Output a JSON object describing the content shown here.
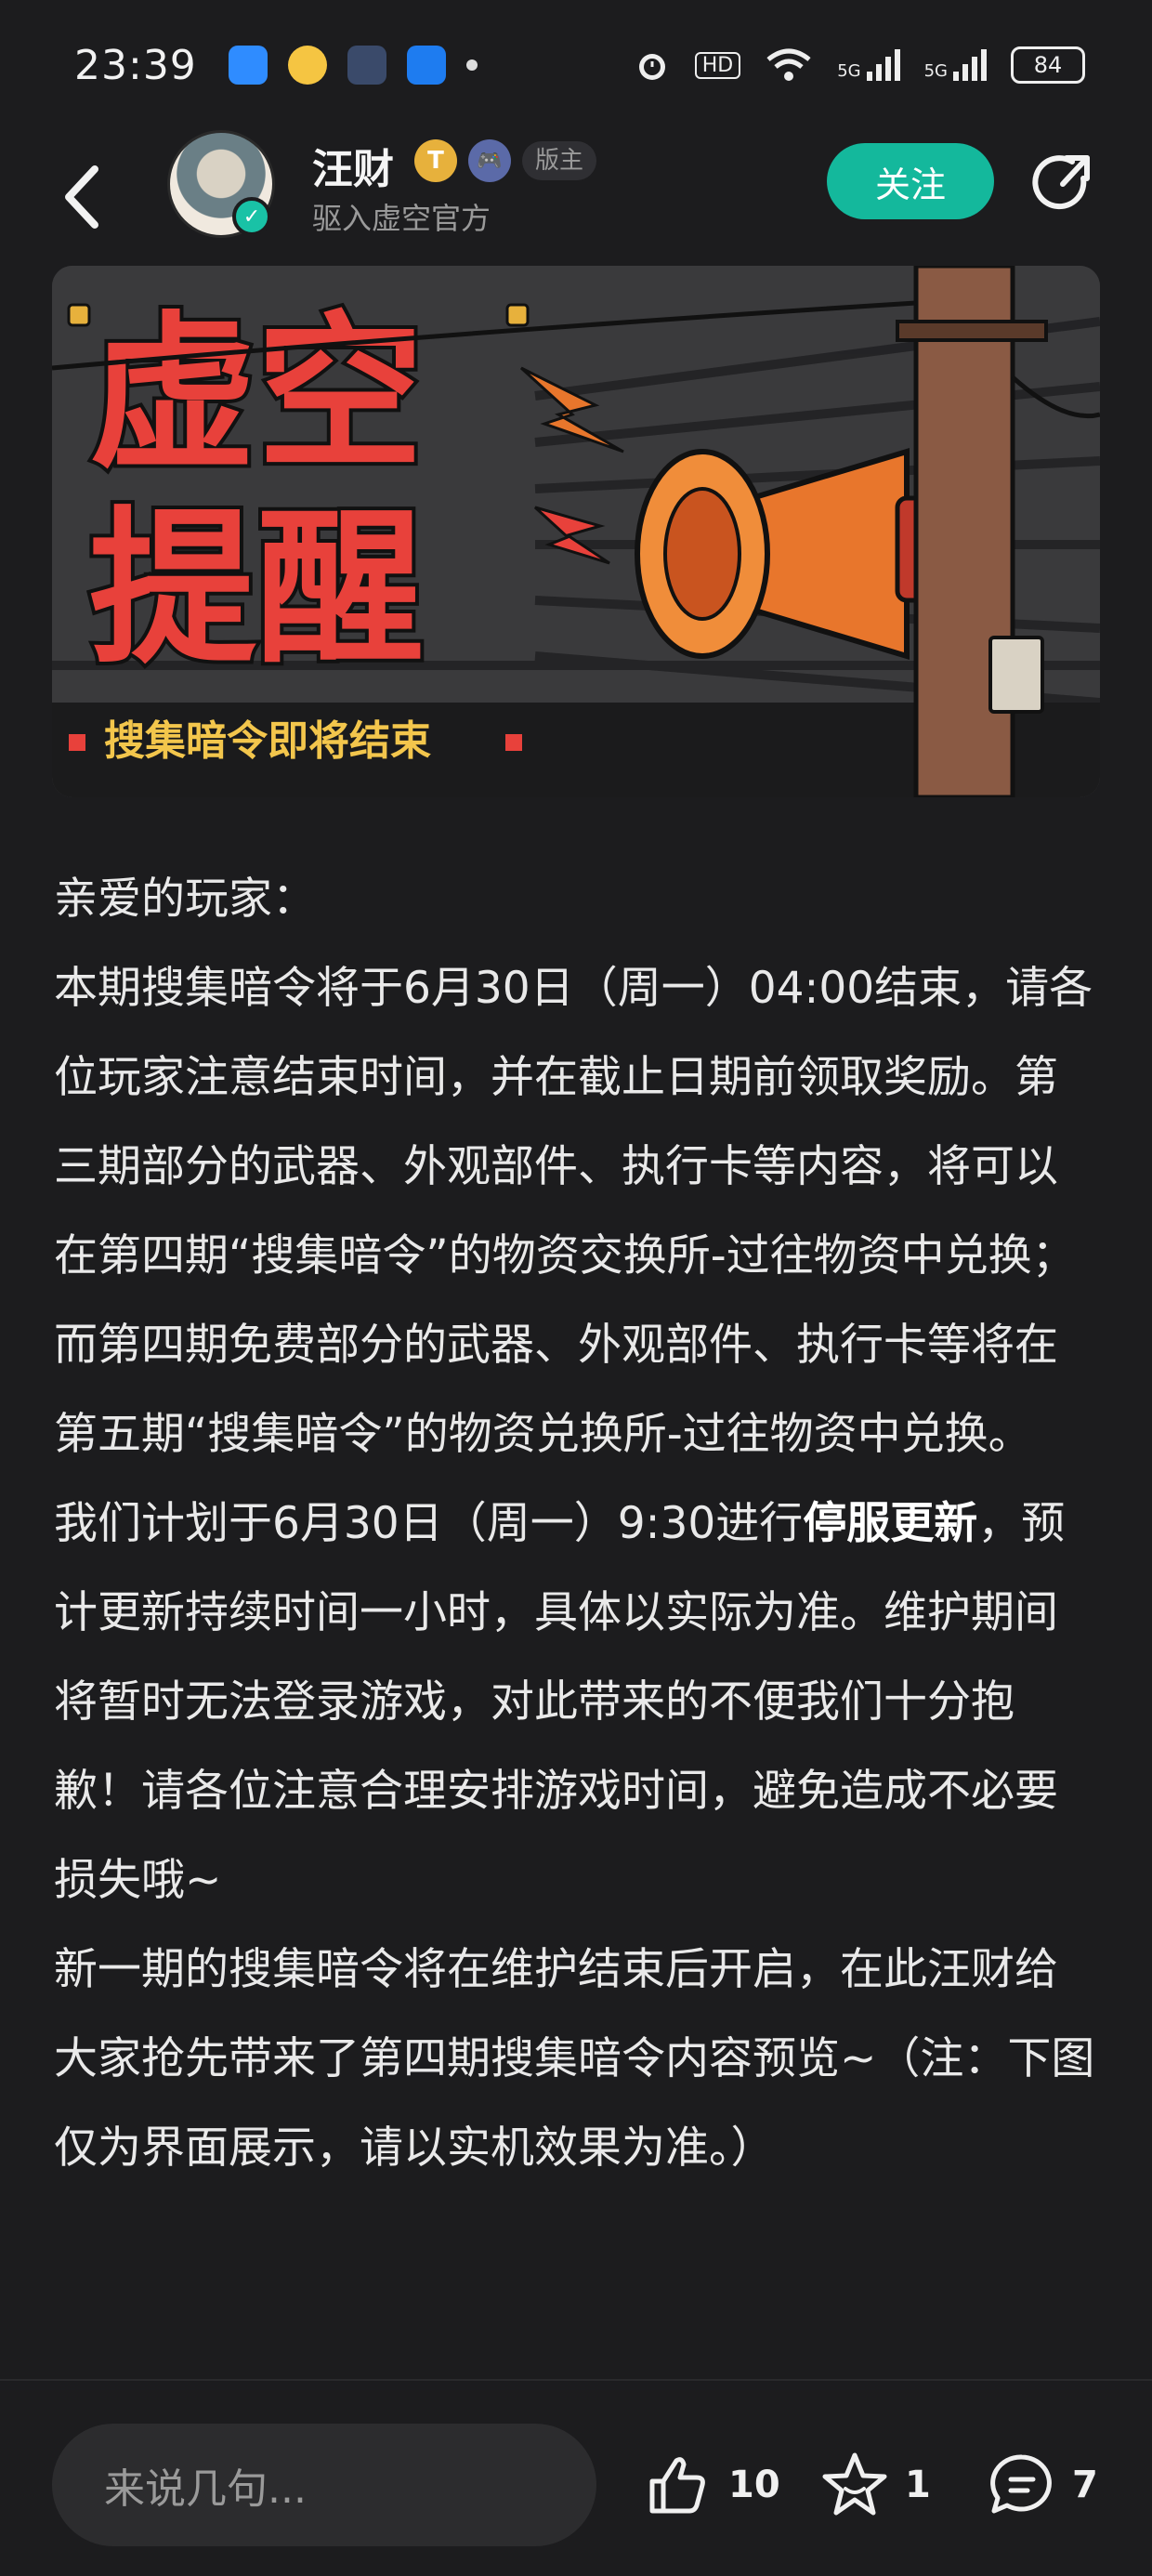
{
  "status_bar": {
    "time": "23:39",
    "network_1": "5G",
    "network_2": "5G",
    "hd_label": "HD",
    "battery": "84",
    "app_icons": [
      "qq-icon",
      "weibo-icon",
      "mail-icon",
      "feishu-icon"
    ]
  },
  "header": {
    "user_name": "汪财",
    "user_badge": "T",
    "moderator_tag": "版主",
    "user_subtitle": "驱入虚空官方",
    "follow_label": "关注"
  },
  "banner": {
    "title_line1": "虚空",
    "title_line2": "提醒",
    "subtitle": "搜集暗令即将结束",
    "colors": {
      "title": "#e8413b",
      "subtitle": "#f3c64c",
      "megaphone": "#e8762c"
    }
  },
  "article": {
    "greeting": "亲爱的玩家：",
    "p1": "本期搜集暗令将于6月30日（周一）04:00结束，请各位玩家注意结束时间，并在截止日期前领取奖励。第三期部分的武器、外观部件、执行卡等内容，将可以在第四期“搜集暗令”的物资交换所-过往物资中兑换；而第四期免费部分的武器、外观部件、执行卡等将在第五期“搜集暗令”的物资兑换所-过往物资中兑换。",
    "p2_before": "我们计划于6月30日（周一）9:30进行",
    "p2_bold": "停服更新",
    "p2_after": "，预计更新持续时间一小时，具体以实际为准。维护期间将暂时无法登录游戏，对此带来的不便我们十分抱歉！请各位注意合理安排游戏时间，避免造成不必要损失哦~",
    "p3": "新一期的搜集暗令将在维护结束后开启，在此汪财给大家抢先带来了第四期搜集暗令内容预览~（注：下图仅为界面展示，请以实机效果为准。）"
  },
  "bottom_bar": {
    "comment_placeholder": "来说几句...",
    "like_count": "10",
    "favorite_count": "1",
    "comment_count": "7",
    "accent": "#14b89c"
  }
}
